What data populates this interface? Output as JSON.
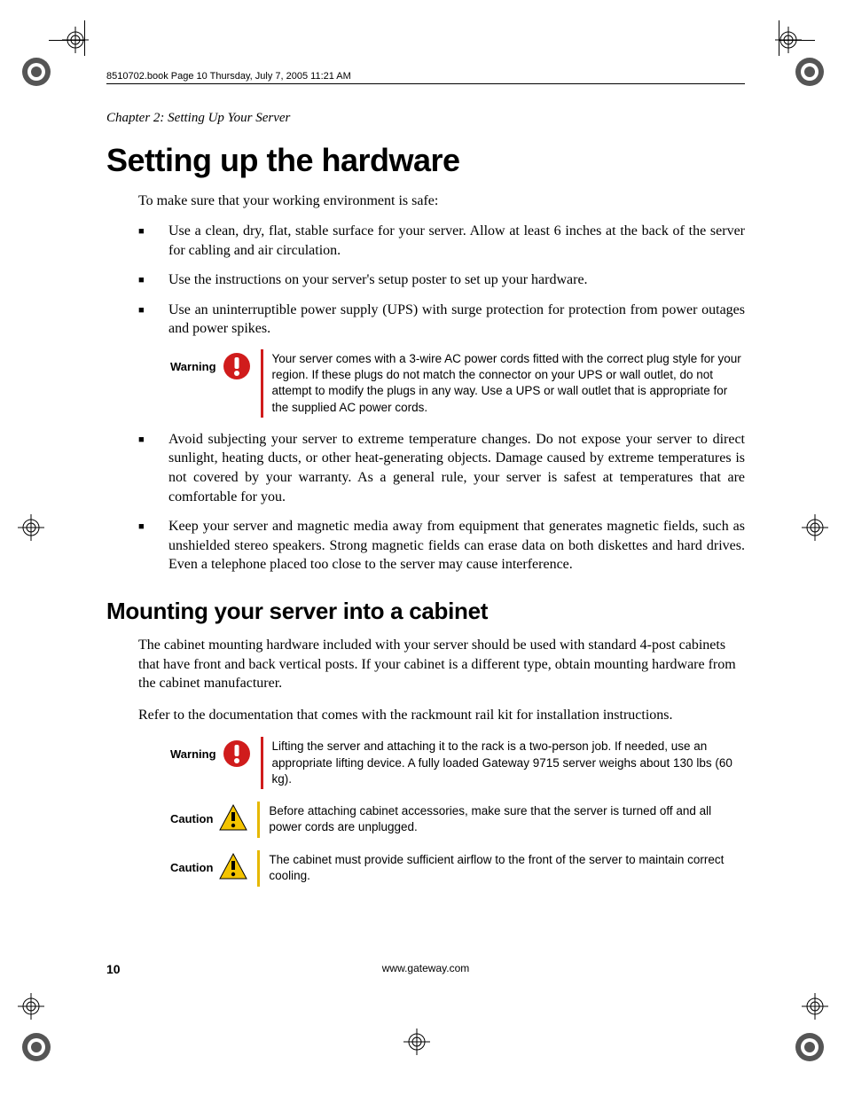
{
  "book_header": "8510702.book  Page 10  Thursday, July 7, 2005  11:21 AM",
  "chapter_line": "Chapter 2: Setting Up Your Server",
  "title": "Setting up the hardware",
  "intro": "To make sure that your working environment is safe:",
  "bullets": {
    "b1": "Use a clean, dry, flat, stable surface for your server. Allow at least 6 inches at the back of the server for cabling and air circulation.",
    "b2": "Use the instructions on your server's setup poster to set up your hardware.",
    "b3": "Use an uninterruptible power supply (UPS) with surge protection for protection from power outages and power spikes.",
    "b4": "Avoid subjecting your server to extreme temperature changes. Do not expose your server to direct sunlight, heating ducts, or other heat-generating objects. Damage caused by extreme temperatures is not covered by your warranty. As a general rule, your server is safest at temperatures that are comfortable for you.",
    "b5": "Keep your server and magnetic media away from equipment that generates magnetic fields, such as unshielded stereo speakers. Strong magnetic fields can erase data on both diskettes and hard drives. Even a telephone placed too close to the server may cause interference."
  },
  "callouts": {
    "warning1": {
      "label": "Warning",
      "text": "Your server comes with a 3-wire AC power cords fitted with the correct plug style for your region. If these plugs do not match the connector on your UPS or wall outlet, do not attempt to modify the plugs in any way. Use a UPS or wall outlet that is appropriate for the supplied AC power cords."
    },
    "warning2": {
      "label": "Warning",
      "text": "Lifting the server and attaching it to the rack is a two-person job. If needed, use an appropriate lifting device. A fully loaded Gateway 9715 server weighs about 130 lbs (60 kg)."
    },
    "caution1": {
      "label": "Caution",
      "text": "Before attaching cabinet accessories, make sure that the server is turned off and all power cords are unplugged."
    },
    "caution2": {
      "label": "Caution",
      "text": "The cabinet must provide sufficient airflow to the front of the server to maintain correct cooling."
    }
  },
  "subheading": "Mounting your server into a cabinet",
  "mount_p1": "The cabinet mounting hardware included with your server should be used with standard 4-post cabinets that have front and back vertical posts. If your cabinet is a different type, obtain mounting hardware from the cabinet manufacturer.",
  "mount_p2": "Refer to the documentation that comes with the rackmount rail kit for installation instructions.",
  "footer": {
    "page_number": "10",
    "url": "www.gateway.com"
  }
}
